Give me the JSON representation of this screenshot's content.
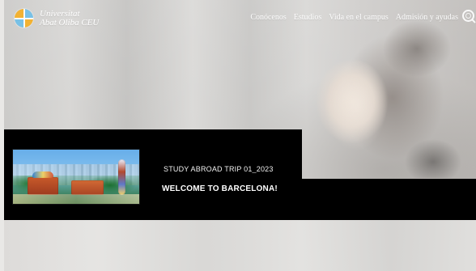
{
  "brand": {
    "line1": "Universitat",
    "line2": "Abat Oliba CEU",
    "logo_icon": "ceu-logo-icon"
  },
  "nav": {
    "items": [
      {
        "label": "Conócenos"
      },
      {
        "label": "Estudios"
      },
      {
        "label": "Vida en el campus"
      },
      {
        "label": "Admisión y ayudas"
      }
    ],
    "search_icon": "search-icon"
  },
  "banner": {
    "trip_label": "STUDY ABROAD TRIP 01_2023",
    "title": "WELCOME TO BARCELONA!",
    "thumbnail": "barcelona-park-thumbnail"
  },
  "colors": {
    "banner_bg": "#000000",
    "text_primary": "#ffffff",
    "logo_yellow": "#f2b233",
    "logo_blue": "#79c1e6"
  }
}
